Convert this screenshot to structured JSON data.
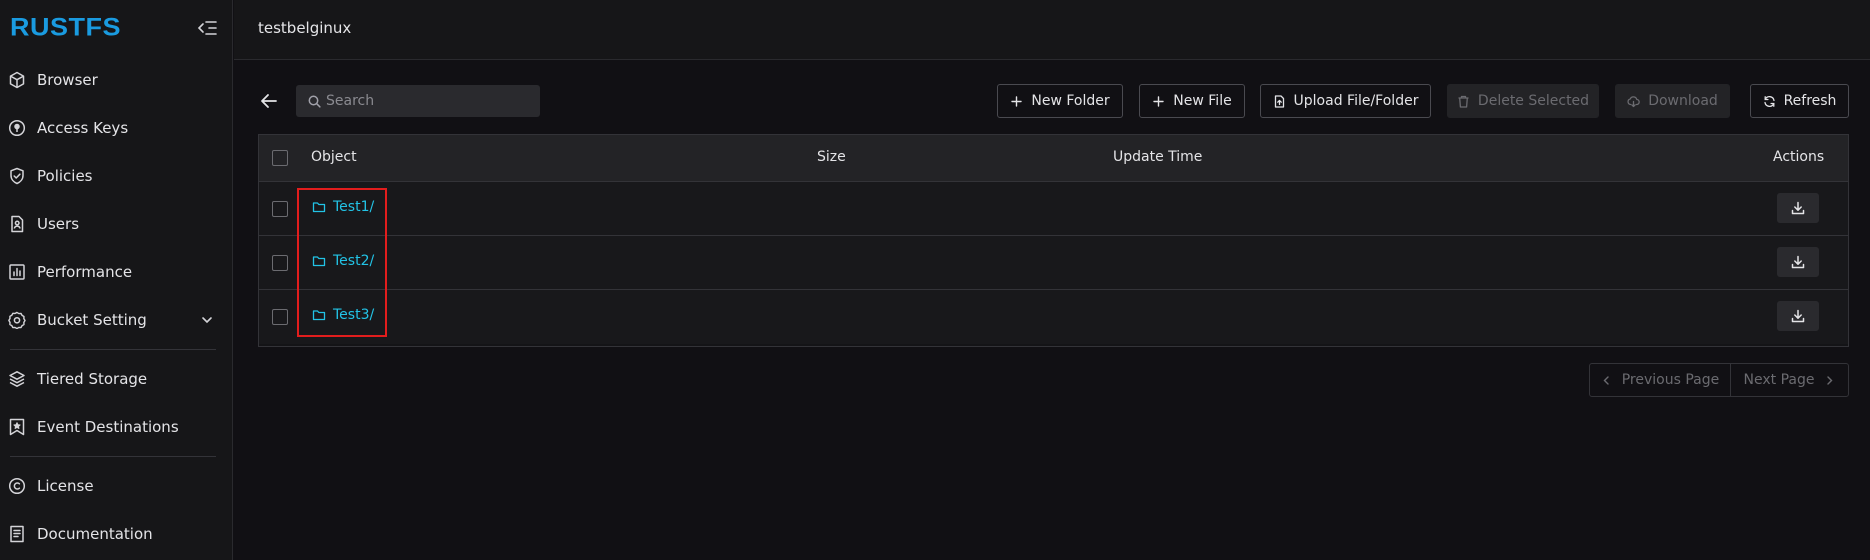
{
  "sidebar": {
    "logo": "RUSTFS",
    "items": [
      {
        "label": "Browser",
        "icon": "cube-icon"
      },
      {
        "label": "Access Keys",
        "icon": "key-circle-icon"
      },
      {
        "label": "Policies",
        "icon": "shield-check-icon"
      },
      {
        "label": "Users",
        "icon": "user-card-icon"
      },
      {
        "label": "Performance",
        "icon": "bar-chart-icon"
      },
      {
        "label": "Bucket Setting",
        "icon": "gear-icon"
      },
      {
        "label": "Tiered Storage",
        "icon": "layers-icon"
      },
      {
        "label": "Event Destinations",
        "icon": "bookmark-star-icon"
      },
      {
        "label": "License",
        "icon": "copyright-icon"
      },
      {
        "label": "Documentation",
        "icon": "document-icon"
      }
    ]
  },
  "header": {
    "bucket": "testbelginux"
  },
  "toolbar": {
    "search_placeholder": "Search",
    "new_folder": "New Folder",
    "new_file": "New File",
    "upload": "Upload File/Folder",
    "delete_selected": "Delete Selected",
    "download": "Download",
    "refresh": "Refresh"
  },
  "table": {
    "columns": [
      "Object",
      "Size",
      "Update Time",
      "Actions"
    ],
    "rows": [
      {
        "name": "Test1/",
        "size": "",
        "update_time": ""
      },
      {
        "name": "Test2/",
        "size": "",
        "update_time": ""
      },
      {
        "name": "Test3/",
        "size": "",
        "update_time": ""
      }
    ]
  },
  "pagination": {
    "previous": "Previous Page",
    "next": "Next Page"
  },
  "colors": {
    "accent": "#22c3e6",
    "logo": "#1a9be0",
    "highlight": "#e21d1d"
  }
}
